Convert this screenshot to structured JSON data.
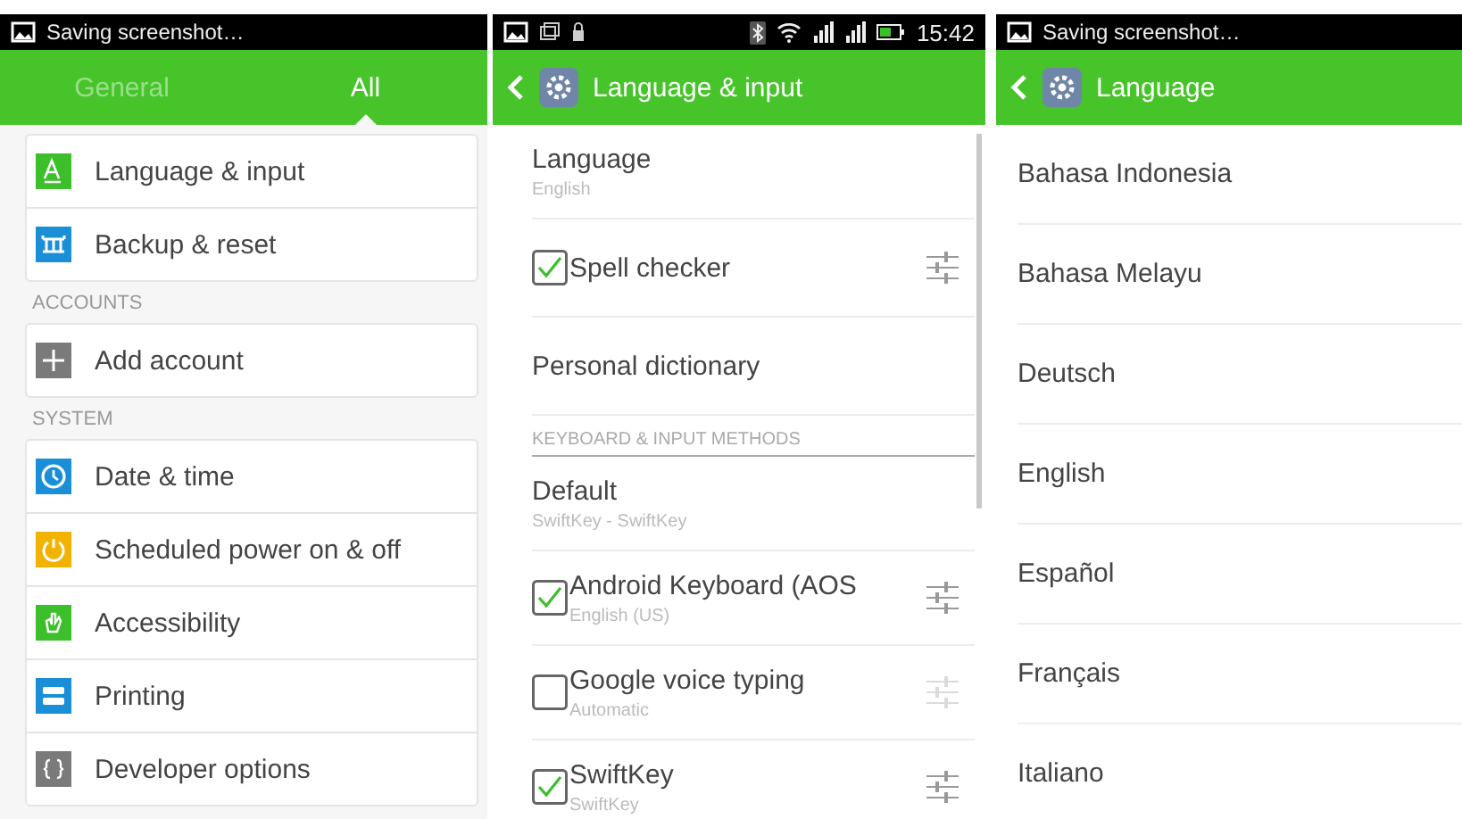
{
  "panels": [
    {
      "kind": "settings",
      "status_bar": {
        "text": "Saving screenshot…"
      },
      "tabs": [
        {
          "label": "General",
          "selected": false
        },
        {
          "label": "All",
          "selected": true
        }
      ],
      "sections": [
        {
          "items": [
            {
              "label": "Language & input",
              "color": "#3cbf2a"
            },
            {
              "label": "Backup & reset",
              "color": "#1a8fd8"
            }
          ]
        },
        {
          "header": "ACCOUNTS",
          "items": [
            {
              "label": "Add account",
              "color": "#7a7a7a"
            }
          ]
        },
        {
          "header": "SYSTEM",
          "items": [
            {
              "label": "Date & time",
              "color": "#1a8fd8"
            },
            {
              "label": "Scheduled power on & off",
              "color": "#f2b200"
            },
            {
              "label": "Accessibility",
              "color": "#3cbf2a"
            },
            {
              "label": "Printing",
              "color": "#1a8fd8"
            },
            {
              "label": "Developer options",
              "color": "#7a7a7a"
            }
          ]
        }
      ]
    },
    {
      "kind": "detail",
      "status_bar": {
        "time": "15:42"
      },
      "title": "Language & input",
      "rows": [
        {
          "kind": "plain",
          "title": "Language",
          "subtitle": "English"
        },
        {
          "kind": "check",
          "title": "Spell checker",
          "checked": true,
          "settings_enabled": true
        },
        {
          "kind": "plain",
          "title": "Personal dictionary"
        },
        {
          "kind": "header",
          "title": "KEYBOARD & INPUT METHODS"
        },
        {
          "kind": "plain",
          "title": "Default",
          "subtitle": "SwiftKey - SwiftKey"
        },
        {
          "kind": "check",
          "title": "Android Keyboard (AOS",
          "subtitle": "English (US)",
          "checked": true,
          "settings_enabled": true
        },
        {
          "kind": "check",
          "title": "Google voice typing",
          "subtitle": "Automatic",
          "checked": false,
          "settings_enabled": false
        },
        {
          "kind": "check",
          "title": "SwiftKey",
          "subtitle": "SwiftKey",
          "checked": true,
          "settings_enabled": true
        }
      ]
    },
    {
      "kind": "list",
      "status_bar": {
        "text": "Saving screenshot…"
      },
      "title": "Language",
      "items": [
        "Bahasa Indonesia",
        "Bahasa Melayu",
        "Deutsch",
        "English",
        "Español",
        "Français",
        "Italiano"
      ]
    }
  ]
}
